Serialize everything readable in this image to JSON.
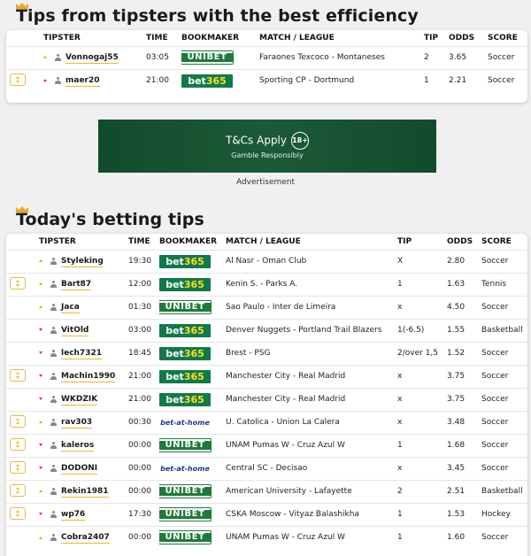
{
  "section1": {
    "title": "Tips from tipsters with the best efficiency",
    "headers": [
      "TIPSTER",
      "TIME",
      "BOOKMAKER",
      "MATCH / LEAGUE",
      "TIP",
      "ODDS",
      "SCORE"
    ],
    "rows": [
      {
        "has_btn": false,
        "trend": "up",
        "tipster": "Vonnogaj55",
        "time": "03:05",
        "bookmaker": "unibet",
        "match": "Faraones Texcoco - Montaneses",
        "tip": "2",
        "odds": "3.65",
        "score": "Soccer"
      },
      {
        "has_btn": true,
        "trend": "down",
        "tipster": "maer20",
        "time": "21:00",
        "bookmaker": "bet365",
        "match": "Sporting CP - Dortmund",
        "tip": "1",
        "odds": "2.21",
        "score": "Soccer"
      }
    ]
  },
  "ad": {
    "line1": "T&Cs Apply",
    "age": "18+",
    "line2": "Gamble Responsibly",
    "caption": "Advertisement"
  },
  "section2": {
    "title": "Today's betting tips",
    "headers": [
      "TIPSTER",
      "TIME",
      "BOOKMAKER",
      "MATCH / LEAGUE",
      "TIP",
      "ODDS",
      "SCORE"
    ],
    "rows": [
      {
        "has_btn": false,
        "trend": "up",
        "tipster": "Styleking",
        "time": "19:30",
        "bookmaker": "bet365",
        "match": "Al Nasr - Oman Club",
        "tip": "X",
        "odds": "2.80",
        "score": "Soccer"
      },
      {
        "has_btn": true,
        "trend": "up",
        "tipster": "Bart87",
        "time": "12:00",
        "bookmaker": "bet365",
        "match": "Kenin S. - Parks A.",
        "tip": "1",
        "odds": "1.63",
        "score": "Tennis"
      },
      {
        "has_btn": false,
        "trend": "up",
        "tipster": "Jaca",
        "time": "01:30",
        "bookmaker": "unibet",
        "match": "Sao Paulo - Inter de Limeira",
        "tip": "x",
        "odds": "4.50",
        "score": "Soccer"
      },
      {
        "has_btn": false,
        "trend": "down",
        "tipster": "VitOld",
        "time": "03:00",
        "bookmaker": "bet365",
        "match": "Denver Nuggets - Portland Trail Blazers",
        "tip": "1(-6.5)",
        "odds": "1.55",
        "score": "Basketball"
      },
      {
        "has_btn": false,
        "trend": "down",
        "tipster": "lech7321",
        "time": "18:45",
        "bookmaker": "bet365",
        "match": "Brest - PSG",
        "tip": "2/over 1,5",
        "odds": "1.52",
        "score": "Soccer"
      },
      {
        "has_btn": true,
        "trend": "down",
        "tipster": "Machin1990",
        "time": "21:00",
        "bookmaker": "bet365",
        "match": "Manchester City - Real Madrid",
        "tip": "x",
        "odds": "3.75",
        "score": "Soccer"
      },
      {
        "has_btn": false,
        "trend": "down",
        "tipster": "WKDZIK",
        "time": "21:00",
        "bookmaker": "bet365",
        "match": "Manchester City - Real Madrid",
        "tip": "x",
        "odds": "3.75",
        "score": "Soccer"
      },
      {
        "has_btn": true,
        "trend": "up",
        "tipster": "rav303",
        "time": "00:30",
        "bookmaker": "bet-at-home",
        "match": "U. Catolica - Union La Calera",
        "tip": "x",
        "odds": "3.48",
        "score": "Soccer"
      },
      {
        "has_btn": true,
        "trend": "down",
        "tipster": "kaleros",
        "time": "00:00",
        "bookmaker": "unibet",
        "match": "UNAM Pumas W - Cruz Azul W",
        "tip": "1",
        "odds": "1.68",
        "score": "Soccer"
      },
      {
        "has_btn": true,
        "trend": "down",
        "tipster": "DODONI",
        "time": "00:00",
        "bookmaker": "bet-at-home",
        "match": "Central SC - Decisao",
        "tip": "x",
        "odds": "3.45",
        "score": "Soccer"
      },
      {
        "has_btn": true,
        "trend": "up",
        "tipster": "Rekin1981",
        "time": "00:00",
        "bookmaker": "unibet",
        "match": "American University - Lafayette",
        "tip": "2",
        "odds": "2.51",
        "score": "Basketball"
      },
      {
        "has_btn": true,
        "trend": "down",
        "tipster": "wp76",
        "time": "17:30",
        "bookmaker": "unibet",
        "match": "CSKA Moscow - Vityaz Balashikha",
        "tip": "1",
        "odds": "1.53",
        "score": "Hockey"
      },
      {
        "has_btn": false,
        "trend": "up",
        "tipster": "Cobra2407",
        "time": "00:00",
        "bookmaker": "unibet",
        "match": "UNAM Pumas W - Cruz Azul W",
        "tip": "1",
        "odds": "1.60",
        "score": "Soccer"
      }
    ]
  },
  "bookmakers": {
    "unibet": "UNIBET",
    "bet365_a": "bet",
    "bet365_b": "365",
    "bet-at-home": "bet-at-home"
  },
  "colors": {
    "accent": "#f0b429",
    "up": "#e8a21a",
    "down": "#d9304b",
    "bet365": "#127a4a",
    "unibet": "#1f7a3a",
    "ad_bg": "#124b2c"
  }
}
